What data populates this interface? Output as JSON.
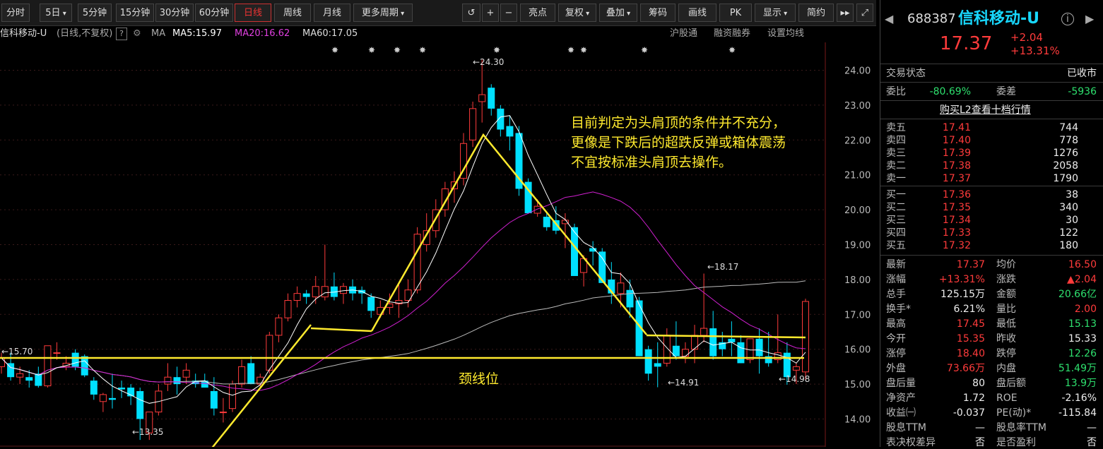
{
  "toolbar": {
    "items": [
      "分时",
      "5日",
      "5分钟",
      "15分钟",
      "30分钟",
      "60分钟",
      "日线",
      "周线",
      "月线",
      "更多周期"
    ],
    "active_index": 6,
    "right_items": [
      "亮点",
      "复权",
      "叠加",
      "筹码",
      "画线",
      "PK",
      "显示",
      "简约"
    ]
  },
  "infobar": {
    "name": "信科移动-U",
    "mode": "(日线,不复权)",
    "help": "?",
    "ma_label": "MA",
    "ma5": "MA5:15.97",
    "ma20": "MA20:16.62",
    "ma60": "MA60:17.05",
    "right1": "沪股通",
    "right2": "融资融券",
    "right3": "设置均线"
  },
  "colors": {
    "up": "#ff3b3b",
    "down": "#00e0ff",
    "ma5": "#ffffff",
    "ma20": "#d020d0",
    "ma60": "#bbbbbb",
    "annotation": "#ffea2e"
  },
  "chart_data": {
    "type": "candlestick",
    "ylim": [
      13.2,
      24.8
    ],
    "yticks": [
      "24.00",
      "23.00",
      "22.00",
      "21.00",
      "20.00",
      "19.00",
      "18.00",
      "17.00",
      "16.00",
      "15.00",
      "14.00"
    ],
    "candles": [
      [
        15.5,
        15.9,
        15.3,
        15.75
      ],
      [
        15.6,
        15.9,
        15.1,
        15.2
      ],
      [
        15.2,
        15.5,
        15.0,
        15.3
      ],
      [
        15.2,
        15.4,
        14.9,
        15.1
      ],
      [
        15.3,
        15.5,
        14.9,
        14.95
      ],
      [
        14.95,
        16.1,
        14.9,
        16.1
      ],
      [
        15.9,
        16.2,
        15.7,
        15.9
      ],
      [
        15.5,
        15.8,
        15.4,
        15.6
      ],
      [
        15.9,
        16.0,
        15.4,
        15.5
      ],
      [
        15.8,
        15.85,
        15.2,
        15.25
      ],
      [
        15.1,
        15.2,
        14.55,
        14.7
      ],
      [
        14.5,
        14.75,
        14.2,
        14.7
      ],
      [
        14.6,
        15.3,
        14.3,
        14.55
      ],
      [
        14.9,
        15.1,
        14.6,
        14.85
      ],
      [
        14.9,
        15.0,
        14.4,
        14.65
      ],
      [
        14.8,
        14.9,
        13.4,
        14.0
      ],
      [
        13.6,
        14.2,
        13.4,
        14.2
      ],
      [
        14.2,
        15.0,
        14.1,
        14.8
      ],
      [
        15.0,
        15.6,
        14.8,
        15.2
      ],
      [
        15.2,
        15.5,
        14.7,
        15.0
      ],
      [
        15.2,
        15.6,
        15.0,
        15.4
      ],
      [
        15.1,
        15.3,
        14.9,
        15.0
      ],
      [
        15.1,
        15.3,
        14.9,
        14.9
      ],
      [
        14.8,
        15.2,
        14.1,
        14.3
      ],
      [
        14.2,
        14.6,
        13.9,
        14.2
      ],
      [
        14.3,
        15.1,
        14.2,
        15.0
      ],
      [
        15.0,
        15.7,
        14.9,
        15.5
      ],
      [
        15.6,
        15.8,
        15.0,
        15.0
      ],
      [
        15.0,
        15.3,
        14.9,
        15.2
      ],
      [
        15.4,
        16.5,
        15.3,
        16.4
      ],
      [
        16.4,
        17.0,
        16.2,
        16.9
      ],
      [
        16.9,
        17.6,
        16.8,
        17.4
      ],
      [
        17.4,
        17.8,
        17.2,
        17.6
      ],
      [
        17.6,
        17.7,
        17.3,
        17.5
      ],
      [
        17.5,
        18.1,
        17.3,
        17.8
      ],
      [
        17.5,
        19.0,
        17.4,
        17.8
      ],
      [
        17.8,
        18.2,
        17.4,
        17.5
      ],
      [
        17.6,
        17.9,
        17.3,
        17.8
      ],
      [
        17.8,
        18.0,
        17.4,
        17.6
      ],
      [
        17.7,
        17.8,
        17.3,
        17.6
      ],
      [
        17.5,
        17.6,
        16.9,
        17.1
      ],
      [
        17.0,
        17.4,
        16.9,
        17.2
      ],
      [
        17.2,
        17.6,
        17.0,
        17.3
      ],
      [
        17.3,
        17.9,
        16.9,
        17.4
      ],
      [
        17.4,
        18.0,
        17.2,
        17.7
      ],
      [
        17.7,
        19.5,
        17.6,
        19.3
      ],
      [
        19.0,
        19.9,
        18.8,
        19.4
      ],
      [
        19.4,
        20.3,
        19.2,
        20.0
      ],
      [
        20.0,
        20.8,
        19.8,
        20.6
      ],
      [
        20.6,
        21.1,
        20.2,
        20.8
      ],
      [
        20.9,
        22.2,
        20.7,
        21.9
      ],
      [
        22.0,
        23.1,
        21.8,
        22.9
      ],
      [
        23.1,
        24.3,
        22.5,
        23.3
      ],
      [
        23.5,
        23.6,
        22.7,
        22.9
      ],
      [
        22.9,
        23.0,
        22.1,
        22.3
      ],
      [
        22.4,
        22.7,
        21.7,
        22.1
      ],
      [
        22.2,
        22.4,
        20.4,
        20.6
      ],
      [
        20.8,
        20.9,
        19.9,
        19.9
      ],
      [
        19.9,
        20.3,
        19.8,
        20.1
      ],
      [
        19.8,
        19.9,
        19.4,
        19.5
      ],
      [
        19.7,
        20.1,
        19.3,
        19.4
      ],
      [
        19.6,
        19.9,
        18.9,
        19.7
      ],
      [
        19.5,
        19.6,
        18.1,
        18.1
      ],
      [
        18.2,
        18.7,
        17.8,
        18.6
      ],
      [
        18.9,
        19.1,
        18.4,
        18.8
      ],
      [
        18.8,
        18.9,
        17.9,
        17.9
      ],
      [
        18.0,
        18.5,
        17.3,
        17.6
      ],
      [
        17.6,
        18.2,
        17.2,
        17.9
      ],
      [
        17.7,
        18.0,
        16.9,
        17.2
      ],
      [
        17.4,
        17.5,
        15.8,
        15.8
      ],
      [
        16.0,
        16.1,
        15.1,
        15.3
      ],
      [
        15.6,
        16.2,
        14.91,
        15.5
      ],
      [
        15.6,
        16.6,
        15.5,
        16.4
      ],
      [
        16.1,
        16.8,
        15.7,
        15.8
      ],
      [
        15.8,
        16.2,
        15.6,
        16.0
      ],
      [
        16.0,
        16.7,
        15.6,
        16.4
      ],
      [
        16.4,
        18.17,
        16.2,
        16.6
      ],
      [
        16.6,
        17.1,
        15.7,
        15.8
      ],
      [
        16.2,
        16.5,
        15.8,
        16.0
      ],
      [
        16.3,
        16.8,
        15.8,
        16.2
      ],
      [
        16.2,
        16.4,
        15.6,
        15.6
      ],
      [
        15.7,
        16.3,
        15.6,
        16.3
      ],
      [
        16.3,
        16.6,
        15.3,
        15.8
      ],
      [
        15.8,
        16.5,
        15.5,
        15.6
      ],
      [
        15.7,
        17.0,
        15.6,
        15.9
      ],
      [
        15.9,
        16.2,
        14.98,
        15.2
      ],
      [
        15.4,
        15.6,
        15.0,
        15.5
      ],
      [
        15.35,
        17.45,
        15.13,
        17.37
      ]
    ],
    "labels": {
      "max": "24.30",
      "min": "13.35",
      "low2": "14.91",
      "low3": "14.98",
      "mid": "18.17",
      "neck": "15.70"
    },
    "annotation": [
      "目前判定为头肩顶的条件并不充分，",
      "更像是下跌后的超跌反弹或箱体震荡",
      "不宜按标准头肩顶去操作。"
    ],
    "neckline_label": "颈线位",
    "neckline_value": 15.75
  },
  "panel": {
    "code": "688387",
    "name": "信科移动-U",
    "price": "17.37",
    "change": "+2.04",
    "change_pct": "+13.31%",
    "status_label": "交易状态",
    "status_value": "已收市",
    "weibi_label": "委比",
    "weibi": "-80.69%",
    "weicha_label": "委差",
    "weicha": "-5936",
    "buy_l2": "购买L2查看十档行情",
    "asks": [
      [
        "卖五",
        "17.41",
        "744"
      ],
      [
        "卖四",
        "17.40",
        "778"
      ],
      [
        "卖三",
        "17.39",
        "1276"
      ],
      [
        "卖二",
        "17.38",
        "2058"
      ],
      [
        "卖一",
        "17.37",
        "1790"
      ]
    ],
    "bids": [
      [
        "买一",
        "17.36",
        "38"
      ],
      [
        "买二",
        "17.35",
        "340"
      ],
      [
        "买三",
        "17.34",
        "30"
      ],
      [
        "买四",
        "17.33",
        "122"
      ],
      [
        "买五",
        "17.32",
        "180"
      ]
    ],
    "stats": [
      [
        "最新",
        "17.37",
        "red",
        "均价",
        "16.50",
        "red"
      ],
      [
        "涨幅",
        "+13.31%",
        "red",
        "涨跌",
        "▲2.04",
        "red"
      ],
      [
        "总手",
        "125.15万",
        "white",
        "金额",
        "20.66亿",
        "green"
      ],
      [
        "换手*",
        "6.21%",
        "white",
        "量比",
        "2.00",
        "red"
      ],
      [
        "最高",
        "17.45",
        "red",
        "最低",
        "15.13",
        "green"
      ],
      [
        "今开",
        "15.35",
        "red",
        "昨收",
        "15.33",
        "white"
      ],
      [
        "涨停",
        "18.40",
        "red",
        "跌停",
        "12.26",
        "green"
      ],
      [
        "外盘",
        "73.66万",
        "red",
        "内盘",
        "51.49万",
        "green"
      ],
      [
        "盘后量",
        "80",
        "white",
        "盘后额",
        "13.9万",
        "green"
      ],
      [
        "净资产",
        "1.72",
        "white",
        "ROE",
        "-2.16%",
        "white"
      ],
      [
        "收益㈠",
        "-0.037",
        "white",
        "PE(动)*",
        "-115.84",
        "white"
      ],
      [
        "股息TTM",
        "—",
        "white",
        "股息率TTM",
        "—",
        "white"
      ],
      [
        "表决权差异",
        "否",
        "white",
        "是否盈利",
        "否",
        "white"
      ]
    ]
  }
}
